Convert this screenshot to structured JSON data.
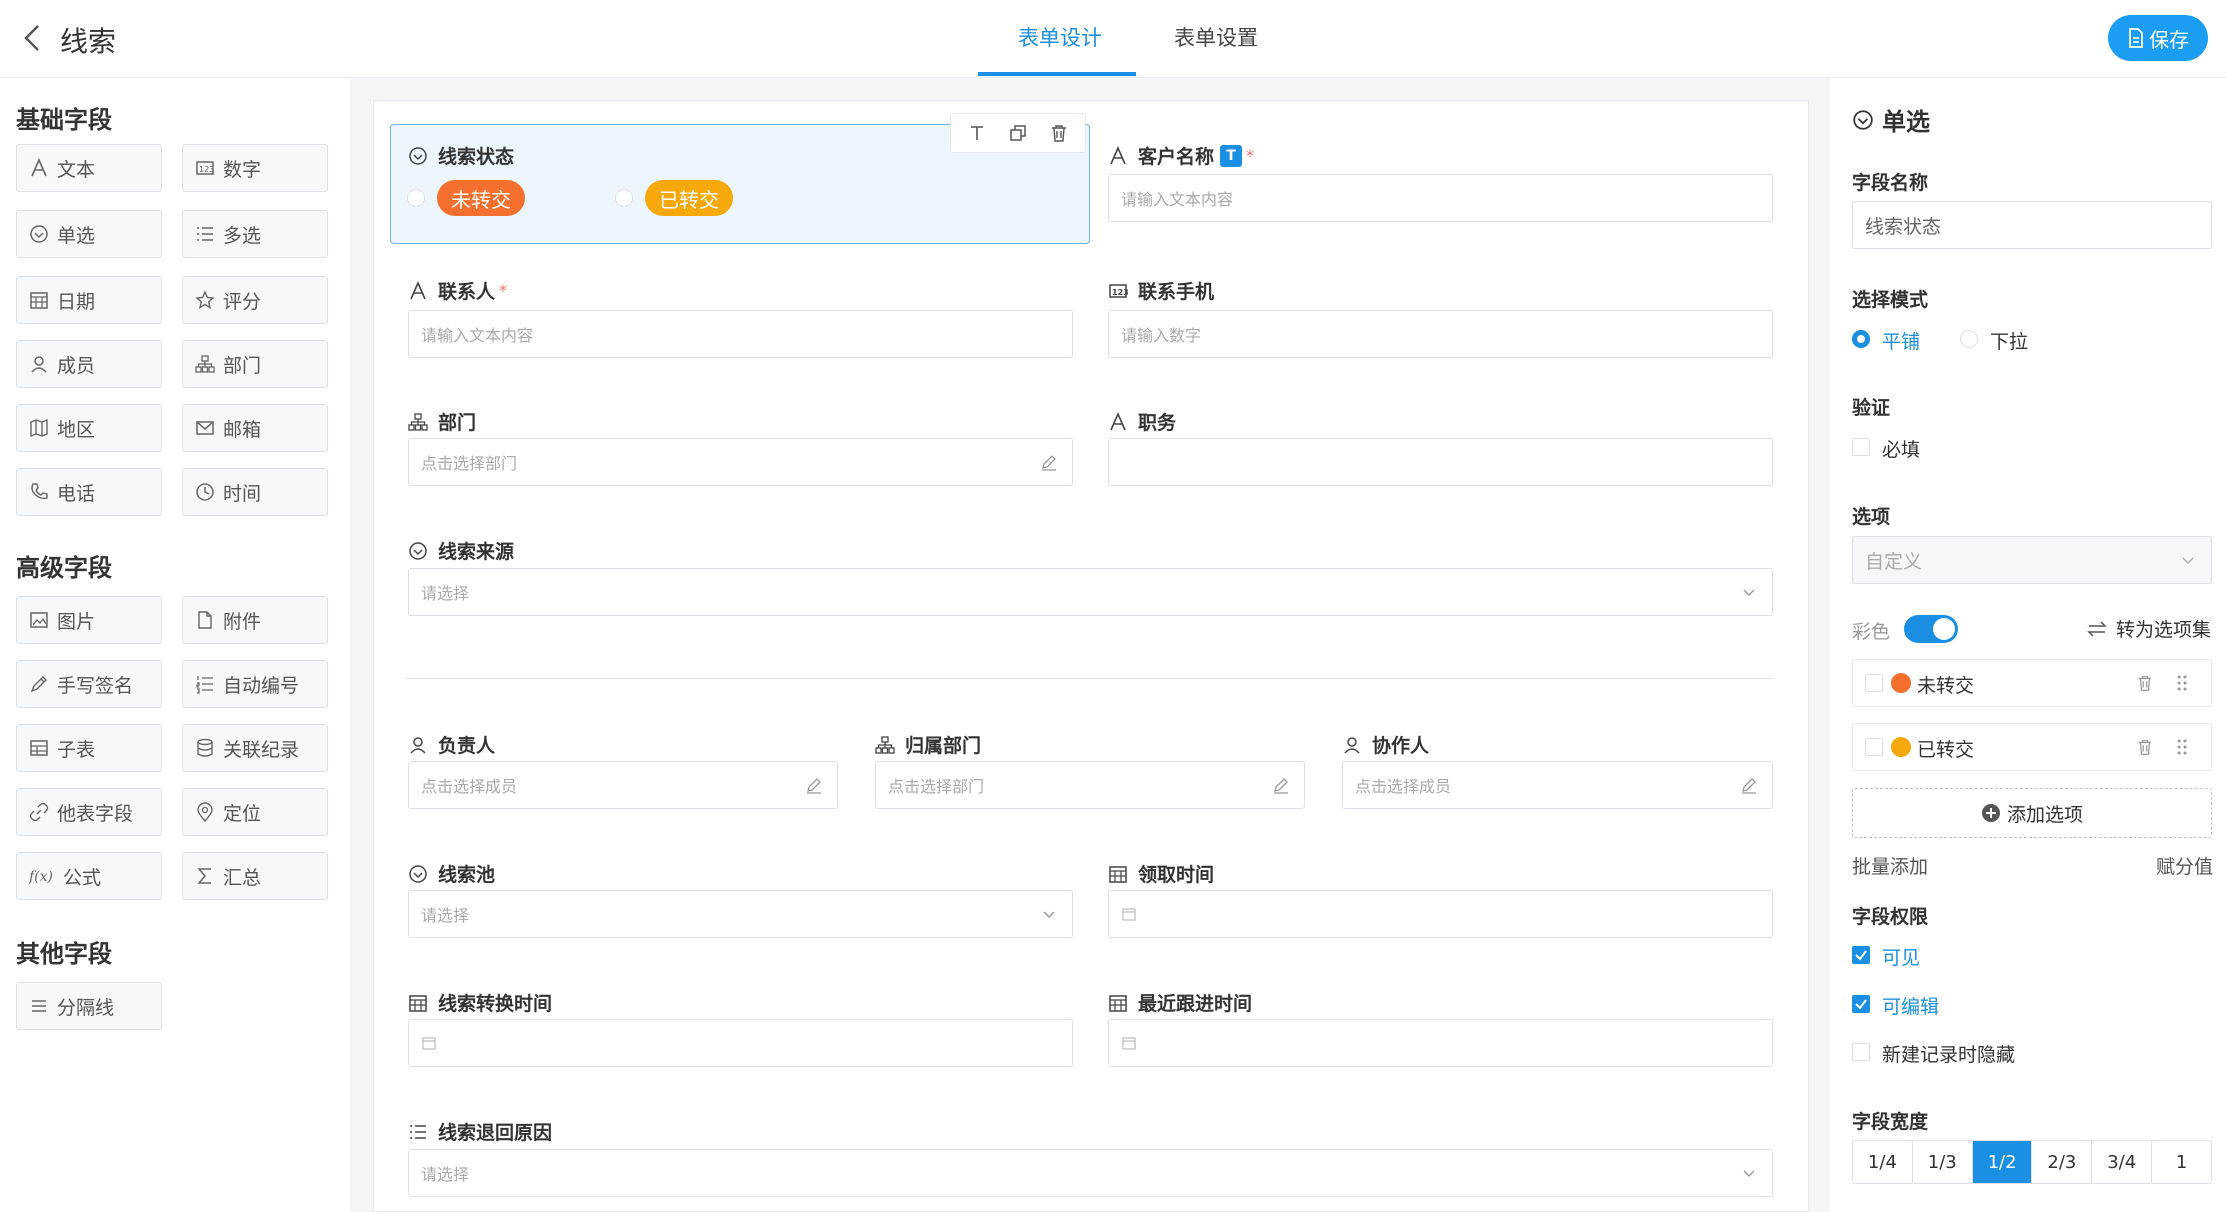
{
  "header": {
    "title": "线索",
    "tabs": [
      {
        "label": "表单设计",
        "active": true
      },
      {
        "label": "表单设置",
        "active": false
      }
    ],
    "save_label": "保存"
  },
  "left": {
    "basic_title": "基础字段",
    "basic": [
      "文本",
      "数字",
      "单选",
      "多选",
      "日期",
      "评分",
      "成员",
      "部门",
      "地区",
      "邮箱",
      "电话",
      "时间"
    ],
    "advanced_title": "高级字段",
    "advanced": [
      "图片",
      "附件",
      "手写签名",
      "自动编号",
      "子表",
      "关联纪录",
      "他表字段",
      "定位",
      "公式",
      "汇总"
    ],
    "other_title": "其他字段",
    "other": [
      "分隔线"
    ]
  },
  "form": {
    "clue_status": {
      "label": "线索状态",
      "options": [
        "未转交",
        "已转交"
      ]
    },
    "customer_name": {
      "label": "客户名称",
      "badge": "T",
      "required": "*",
      "placeholder": "请输入文本内容"
    },
    "contact": {
      "label": "联系人",
      "required": "*",
      "placeholder": "请输入文本内容"
    },
    "phone": {
      "label": "联系手机",
      "placeholder": "请输入数字"
    },
    "dept": {
      "label": "部门",
      "placeholder": "点击选择部门"
    },
    "position": {
      "label": "职务",
      "placeholder": ""
    },
    "source": {
      "label": "线索来源",
      "placeholder": "请选择"
    },
    "owner": {
      "label": "负责人",
      "placeholder": "点击选择成员"
    },
    "owner_dept": {
      "label": "归属部门",
      "placeholder": "点击选择部门"
    },
    "collaborator": {
      "label": "协作人",
      "placeholder": "点击选择成员"
    },
    "pool": {
      "label": "线索池",
      "placeholder": "请选择"
    },
    "claim_time": {
      "label": "领取时间"
    },
    "convert_time": {
      "label": "线索转换时间"
    },
    "followup_time": {
      "label": "最近跟进时间"
    },
    "return_reason": {
      "label": "线索退回原因",
      "placeholder": "请选择"
    }
  },
  "panel": {
    "title": "单选",
    "name_label": "字段名称",
    "name_value": "线索状态",
    "mode_label": "选择模式",
    "mode_options": [
      "平铺",
      "下拉"
    ],
    "verify_label": "验证",
    "required_label": "必填",
    "options_label": "选项",
    "options_source": "自定义",
    "color_label": "彩色",
    "color_on": true,
    "convert_label": "转为选项集",
    "options": [
      {
        "label": "未转交",
        "color": "#f5702f"
      },
      {
        "label": "已转交",
        "color": "#f7a90c"
      }
    ],
    "add_option": "添加选项",
    "batch_add": "批量添加",
    "assign_value": "赋分值",
    "perm_label": "字段权限",
    "perm_visible": "可见",
    "perm_editable": "可编辑",
    "perm_hide_new": "新建记录时隐藏",
    "width_label": "字段宽度",
    "widths": [
      "1/4",
      "1/3",
      "1/2",
      "2/3",
      "3/4",
      "1"
    ],
    "width_active": "1/2"
  },
  "colors": {
    "accent": "#1a8fe3",
    "tag_orange": "#f5702f",
    "tag_yellow": "#f7a90c"
  }
}
